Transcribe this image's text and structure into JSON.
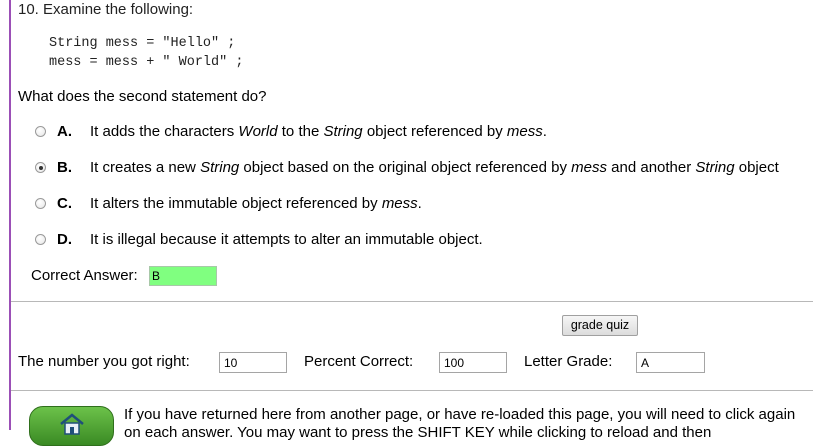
{
  "question": {
    "title": "10. Examine the following:",
    "code_line_1": "String mess = \"Hello\" ;",
    "code_line_2": "mess = mess + \" World\" ;",
    "prompt": "What does the second statement do?"
  },
  "choices": [
    {
      "letter": "A.",
      "selected": false,
      "parts": [
        "It adds the characters ",
        "World",
        " to the ",
        "String",
        " object referenced by ",
        "mess",
        "."
      ]
    },
    {
      "letter": "B.",
      "selected": true,
      "parts": [
        "It creates a new ",
        "String",
        " object based on the original object referenced by ",
        "mess",
        " and another ",
        "String",
        " object"
      ]
    },
    {
      "letter": "C.",
      "selected": false,
      "parts": [
        "It alters the immutable object referenced by ",
        "mess",
        "."
      ]
    },
    {
      "letter": "D.",
      "selected": false,
      "parts": [
        "It is illegal because it attempts to alter an immutable object."
      ]
    }
  ],
  "answer": {
    "label": "Correct Answer:",
    "value": "B",
    "field_color": "#80ff80"
  },
  "grading": {
    "button_label": "grade quiz",
    "right_label": "The number you got right:",
    "right_value": "10",
    "percent_label": "Percent Correct:",
    "percent_value": "100",
    "grade_label": "Letter Grade:",
    "grade_value": "A"
  },
  "footer": {
    "home_icon": "home-icon",
    "line_1": "If you have returned here from another page, or have re-loaded this page, you will need to click again",
    "line_2": "on each answer. You may want to press the SHIFT KEY while clicking to reload and then"
  },
  "accent_color": "#9b4fb6"
}
